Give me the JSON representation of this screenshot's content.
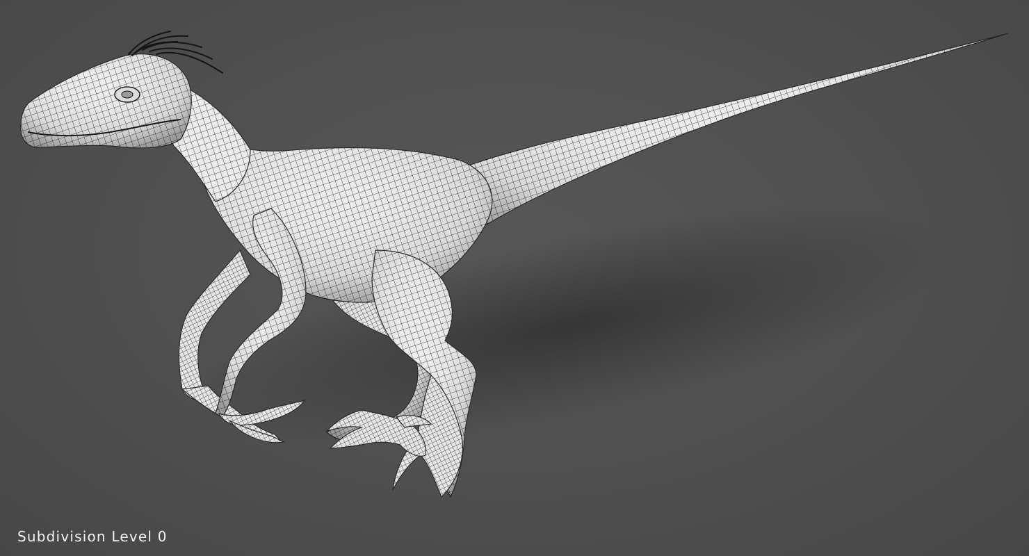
{
  "viewport": {
    "caption": "Subdivision Level 0",
    "background_color": "#4e4e4e",
    "model_color": "#ececec",
    "wire_color": "#1a1a1a",
    "subject": "velociraptor-wireframe-model-icon"
  }
}
